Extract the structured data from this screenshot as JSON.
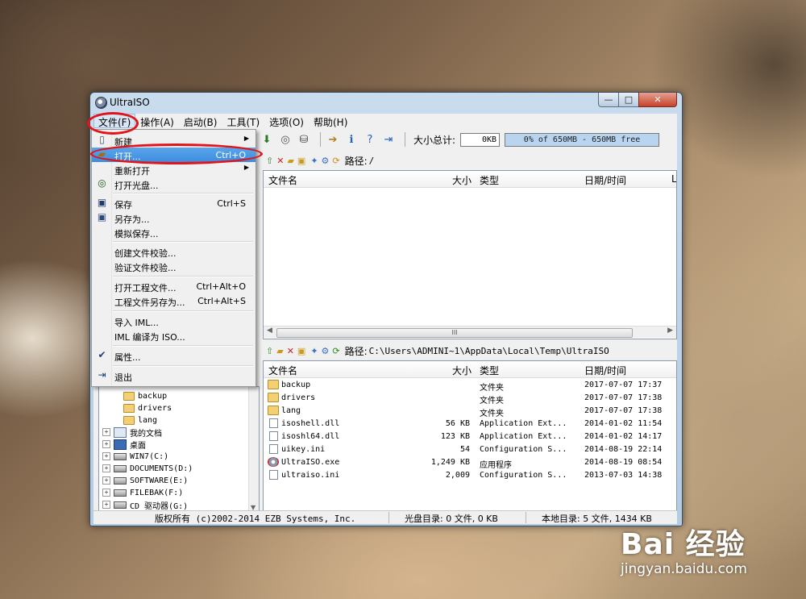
{
  "window": {
    "title": "UltraISO",
    "min": "—",
    "max": "□",
    "close": "✕"
  },
  "menubar": [
    {
      "label": "文件(F)"
    },
    {
      "label": "操作(A)"
    },
    {
      "label": "启动(B)"
    },
    {
      "label": "工具(T)"
    },
    {
      "label": "选项(O)"
    },
    {
      "label": "帮助(H)"
    }
  ],
  "toolbar": {
    "total_label": "大小总计:",
    "total_value": "0KB",
    "capacity": "0% of 650MB - 650MB free"
  },
  "iso_pane": {
    "path_label": "路径:",
    "path_value": "/",
    "columns": {
      "name": "文件名",
      "size": "大小",
      "type": "类型",
      "date": "日期/时间",
      "extra": "L"
    },
    "hscroll_thumb": "III"
  },
  "local_pane": {
    "path_label": "路径:",
    "path_value": "C:\\Users\\ADMINI~1\\AppData\\Local\\Temp\\UltraISO",
    "columns": {
      "name": "文件名",
      "size": "大小",
      "type": "类型",
      "date": "日期/时间"
    },
    "rows": [
      {
        "icon": "folder-icon",
        "name": "backup",
        "size": "",
        "type": "文件夹",
        "date": "2017-07-07 17:37"
      },
      {
        "icon": "folder-icon",
        "name": "drivers",
        "size": "",
        "type": "文件夹",
        "date": "2017-07-07 17:38"
      },
      {
        "icon": "folder-icon",
        "name": "lang",
        "size": "",
        "type": "文件夹",
        "date": "2017-07-07 17:38"
      },
      {
        "icon": "dll-file-icon",
        "name": "isoshell.dll",
        "size": "56 KB",
        "type": "Application Ext...",
        "date": "2014-01-02 11:54"
      },
      {
        "icon": "dll-file-icon",
        "name": "isoshl64.dll",
        "size": "123 KB",
        "type": "Application Ext...",
        "date": "2014-01-02 14:17"
      },
      {
        "icon": "ini-file-icon",
        "name": "uikey.ini",
        "size": "54",
        "type": "Configuration S...",
        "date": "2014-08-19 22:14"
      },
      {
        "icon": "exe-file-icon",
        "name": "UltraISO.exe",
        "size": "1,249 KB",
        "type": "应用程序",
        "date": "2014-08-19 08:54"
      },
      {
        "icon": "ini-file-icon",
        "name": "ultraiso.ini",
        "size": "2,009",
        "type": "Configuration S...",
        "date": "2013-07-03 14:38"
      }
    ]
  },
  "tree": [
    {
      "label": "backup",
      "icon": "folder-icon"
    },
    {
      "label": "drivers",
      "icon": "folder-icon"
    },
    {
      "label": "lang",
      "icon": "folder-icon"
    },
    {
      "label": "我的文档",
      "icon": "documents-icon"
    },
    {
      "label": "桌面",
      "icon": "desktop-icon"
    },
    {
      "label": "WIN7(C:)",
      "icon": "drive-icon"
    },
    {
      "label": "DOCUMENTS(D:)",
      "icon": "drive-icon"
    },
    {
      "label": "SOFTWARE(E:)",
      "icon": "drive-icon"
    },
    {
      "label": "FILEBAK(F:)",
      "icon": "drive-icon"
    },
    {
      "label": "CD 驱动器(G:)",
      "icon": "cd-drive-icon"
    }
  ],
  "status": {
    "copyright": "版权所有 (c)2002-2014 EZB Systems, Inc.",
    "iso_dir": "光盘目录: 0 文件, 0 KB",
    "local_dir": "本地目录: 5 文件, 1434 KB"
  },
  "file_menu": [
    {
      "label": "新建",
      "shortcut": "",
      "submenu": true,
      "icon": "new-icon"
    },
    {
      "label": "打开...",
      "shortcut": "Ctrl+O",
      "submenu": false,
      "icon": "open-folder-icon",
      "highlighted": true
    },
    {
      "label": "重新打开",
      "shortcut": "",
      "submenu": true,
      "icon": ""
    },
    {
      "label": "打开光盘...",
      "shortcut": "",
      "submenu": false,
      "icon": "open-disc-icon"
    },
    {
      "label": "保存",
      "shortcut": "Ctrl+S",
      "submenu": false,
      "icon": "save-icon"
    },
    {
      "label": "另存为...",
      "shortcut": "",
      "submenu": false,
      "icon": "save-as-icon"
    },
    {
      "label": "模拟保存...",
      "shortcut": "",
      "submenu": false,
      "icon": ""
    },
    {
      "label": "创建文件校验...",
      "shortcut": "",
      "submenu": false,
      "icon": ""
    },
    {
      "label": "验证文件校验...",
      "shortcut": "",
      "submenu": false,
      "icon": ""
    },
    {
      "label": "打开工程文件...",
      "shortcut": "Ctrl+Alt+O",
      "submenu": false,
      "icon": ""
    },
    {
      "label": "工程文件另存为...",
      "shortcut": "Ctrl+Alt+S",
      "submenu": false,
      "icon": ""
    },
    {
      "label": "导入 IML...",
      "shortcut": "",
      "submenu": false,
      "icon": ""
    },
    {
      "label": "IML 编译为 ISO...",
      "shortcut": "",
      "submenu": false,
      "icon": ""
    },
    {
      "label": "属性...",
      "shortcut": "",
      "submenu": false,
      "icon": "properties-icon"
    },
    {
      "label": "退出",
      "shortcut": "",
      "submenu": false,
      "icon": "exit-icon"
    }
  ],
  "watermark": {
    "brand": "Bai 经验",
    "url": "jingyan.baidu.com"
  },
  "colors": {
    "highlight": "#3d8ee0",
    "annotation": "#e0141a",
    "capacity_bar": "#b8d4ee"
  }
}
